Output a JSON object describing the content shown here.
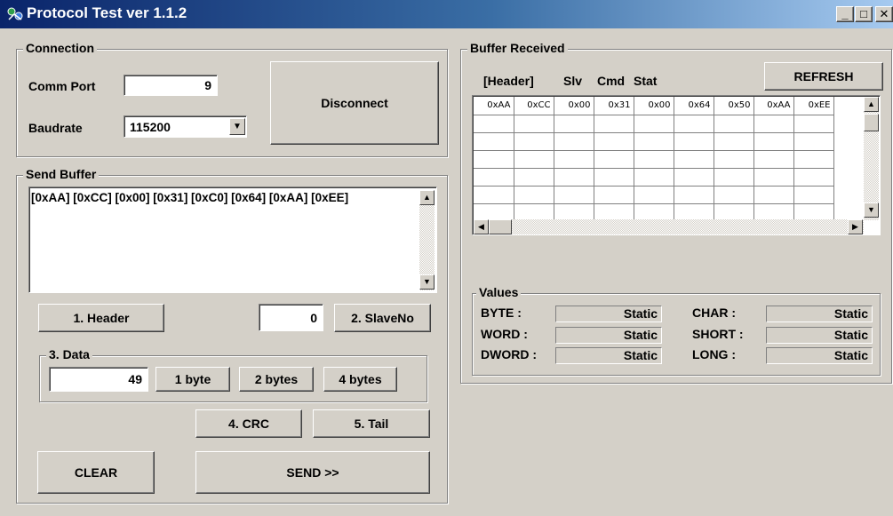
{
  "window": {
    "title": "Protocol Test ver 1.1.2",
    "controls": {
      "minimize": "_",
      "maximize": "□",
      "close": "✕"
    }
  },
  "connection": {
    "group_label": "Connection",
    "comm_port_label": "Comm Port",
    "comm_port_value": "9",
    "baudrate_label": "Baudrate",
    "baudrate_value": "115200",
    "disconnect_label": "Disconnect"
  },
  "send_buffer": {
    "group_label": "Send Buffer",
    "content": "[0xAA] [0xCC] [0x00] [0x31] [0xC0] [0x64] [0xAA] [0xEE]",
    "header_button": "1. Header",
    "slave_value": "0",
    "slave_button": "2. SlaveNo",
    "data_group_label": "3. Data",
    "data_value": "49",
    "one_byte_button": "1 byte",
    "two_bytes_button": "2 bytes",
    "four_bytes_button": "4 bytes",
    "crc_button": "4. CRC",
    "tail_button": "5. Tail",
    "clear_button": "CLEAR",
    "send_button": "SEND >>"
  },
  "buffer_received": {
    "group_label": "Buffer Received",
    "headers": {
      "header": "[Header]",
      "slv": "Slv",
      "cmd": "Cmd",
      "stat": "Stat"
    },
    "refresh_button": "REFRESH",
    "rows": [
      [
        "0xAA",
        "0xCC",
        "0x00",
        "0x31",
        "0x00",
        "0x64",
        "0x50",
        "0xAA",
        "0xEE"
      ],
      [
        "",
        "",
        "",
        "",
        "",
        "",
        "",
        "",
        ""
      ],
      [
        "",
        "",
        "",
        "",
        "",
        "",
        "",
        "",
        ""
      ],
      [
        "",
        "",
        "",
        "",
        "",
        "",
        "",
        "",
        ""
      ],
      [
        "",
        "",
        "",
        "",
        "",
        "",
        "",
        "",
        ""
      ],
      [
        "",
        "",
        "",
        "",
        "",
        "",
        "",
        "",
        ""
      ],
      [
        "",
        "",
        "",
        "",
        "",
        "",
        "",
        "",
        ""
      ]
    ]
  },
  "values": {
    "group_label": "Values",
    "byte_label": "BYTE :",
    "byte_value": "Static",
    "word_label": "WORD :",
    "word_value": "Static",
    "dword_label": "DWORD :",
    "dword_value": "Static",
    "char_label": "CHAR :",
    "char_value": "Static",
    "short_label": "SHORT :",
    "short_value": "Static",
    "long_label": "LONG :",
    "long_value": "Static"
  }
}
